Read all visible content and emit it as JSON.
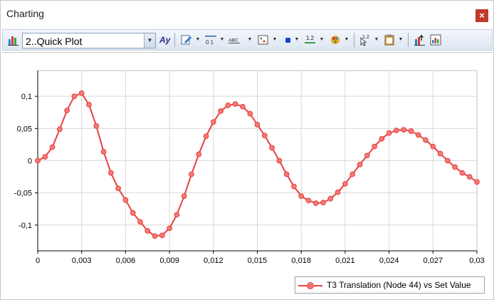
{
  "window": {
    "title": "Charting",
    "close_label": "×"
  },
  "toolbar": {
    "plot_selector_value": "2..Quick Plot",
    "icons": [
      "bar-chart-icon",
      "font-style-icon",
      "edit-pen-icon",
      "axis-scale-icon",
      "text-style-icon",
      "marker-icon",
      "series-color-icon",
      "number-format-icon",
      "palette-icon",
      "cursor-value-icon",
      "clipboard-icon",
      "export-chart-icon",
      "chart-settings-icon"
    ]
  },
  "colors": {
    "series": "#e8413f",
    "series_marker_fill": "#f27a78",
    "grid": "#d9d9d9",
    "axis": "#000000"
  },
  "chart_data": {
    "type": "line",
    "title": "",
    "xlabel": "",
    "ylabel": "",
    "xlim": [
      0,
      0.03
    ],
    "ylim": [
      -0.14,
      0.14
    ],
    "x_ticks": [
      "0",
      "0,003",
      "0,006",
      "0,009",
      "0,012",
      "0,015",
      "0,018",
      "0,021",
      "0,024",
      "0,027",
      "0,03"
    ],
    "y_ticks": [
      "0,1",
      "0,05",
      "0",
      "-0,05",
      "-0,1"
    ],
    "y_tick_values": [
      0.1,
      0.05,
      0,
      -0.05,
      -0.1
    ],
    "grid": true,
    "legend_position": "bottom-right",
    "series": [
      {
        "name": "T3 Translation (Node 44) vs Set Value",
        "x": [
          0,
          0.0005,
          0.001,
          0.0015,
          0.002,
          0.0025,
          0.003,
          0.0035,
          0.004,
          0.0045,
          0.005,
          0.0055,
          0.006,
          0.0065,
          0.007,
          0.0075,
          0.008,
          0.0085,
          0.009,
          0.0095,
          0.01,
          0.0105,
          0.011,
          0.0115,
          0.012,
          0.0125,
          0.013,
          0.0135,
          0.014,
          0.0145,
          0.015,
          0.0155,
          0.016,
          0.0165,
          0.017,
          0.0175,
          0.018,
          0.0185,
          0.019,
          0.0195,
          0.02,
          0.0205,
          0.021,
          0.0215,
          0.022,
          0.0225,
          0.023,
          0.0235,
          0.024,
          0.0245,
          0.025,
          0.0255,
          0.026,
          0.0265,
          0.027,
          0.0275,
          0.028,
          0.0285,
          0.029,
          0.0295,
          0.03
        ],
        "y": [
          0,
          0.006,
          0.021,
          0.049,
          0.078,
          0.1,
          0.105,
          0.087,
          0.054,
          0.014,
          -0.019,
          -0.043,
          -0.061,
          -0.081,
          -0.095,
          -0.109,
          -0.117,
          -0.116,
          -0.105,
          -0.084,
          -0.055,
          -0.021,
          0.01,
          0.038,
          0.06,
          0.077,
          0.086,
          0.088,
          0.084,
          0.073,
          0.056,
          0.039,
          0.02,
          0,
          -0.021,
          -0.04,
          -0.055,
          -0.062,
          -0.066,
          -0.065,
          -0.059,
          -0.049,
          -0.036,
          -0.021,
          -0.006,
          0.008,
          0.022,
          0.034,
          0.043,
          0.047,
          0.048,
          0.046,
          0.04,
          0.032,
          0.022,
          0.011,
          0,
          -0.01,
          -0.019,
          -0.025,
          -0.033
        ]
      }
    ]
  }
}
